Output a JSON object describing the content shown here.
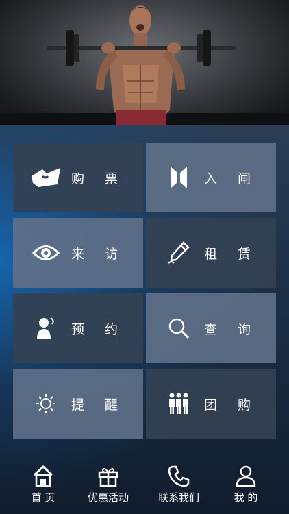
{
  "tiles": [
    {
      "label": "购 票",
      "icon": "ticket-icon"
    },
    {
      "label": "入 闸",
      "icon": "gate-icon"
    },
    {
      "label": "来 访",
      "icon": "eye-icon"
    },
    {
      "label": "租 赁",
      "icon": "pencil-icon"
    },
    {
      "label": "预 约",
      "icon": "user-talk-icon"
    },
    {
      "label": "查 询",
      "icon": "search-icon"
    },
    {
      "label": "提 醒",
      "icon": "sun-icon"
    },
    {
      "label": "团 购",
      "icon": "group-icon"
    }
  ],
  "tabbar": {
    "home": "首 页",
    "promotions": "优惠活动",
    "contact": "联系我们",
    "mine": "我 的"
  },
  "colors": {
    "tile_dark": "#344154",
    "tile_light": "#607088",
    "accent_glow": "#146ebe"
  }
}
